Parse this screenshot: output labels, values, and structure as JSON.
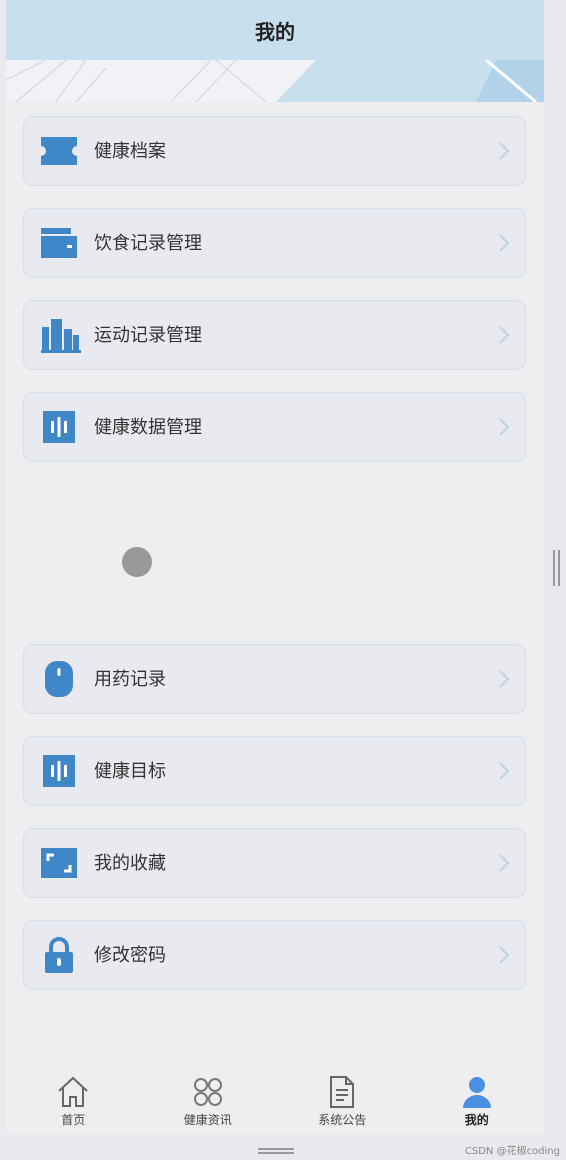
{
  "header": {
    "title": "我的"
  },
  "menu": {
    "items": [
      {
        "label": "健康档案",
        "icon": "ticket-icon"
      },
      {
        "label": "饮食记录管理",
        "icon": "wallet-icon"
      },
      {
        "label": "运动记录管理",
        "icon": "buildings-icon"
      },
      {
        "label": "健康数据管理",
        "icon": "data-bars-icon"
      },
      {
        "label": "用药记录",
        "icon": "pill-icon"
      },
      {
        "label": "健康目标",
        "icon": "target-bars-icon"
      },
      {
        "label": "我的收藏",
        "icon": "frame-icon"
      },
      {
        "label": "修改密码",
        "icon": "lock-icon"
      }
    ]
  },
  "tabbar": {
    "tabs": [
      {
        "label": "首页",
        "icon": "home-icon",
        "active": false
      },
      {
        "label": "健康资讯",
        "icon": "grid-circles-icon",
        "active": false
      },
      {
        "label": "系统公告",
        "icon": "document-icon",
        "active": false
      },
      {
        "label": "我的",
        "icon": "user-icon",
        "active": true
      }
    ]
  },
  "watermark": {
    "text": "CSDN @花椒coding"
  },
  "colors": {
    "accent": "#3f87c6",
    "header_bg": "#c8dfee",
    "active_tab": "#4a90e2"
  }
}
